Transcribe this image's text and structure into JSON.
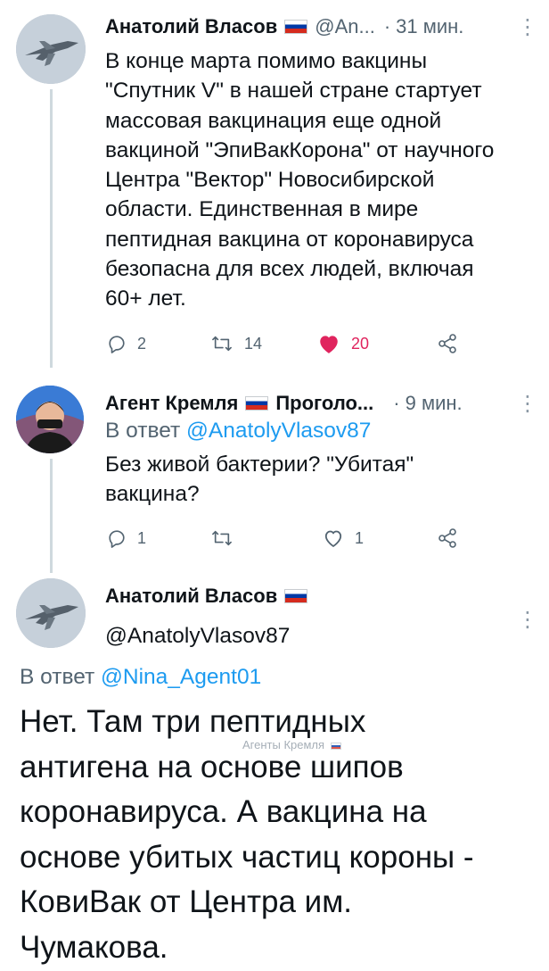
{
  "tweet1": {
    "author_name": "Анатолий Власов",
    "handle": "@An...",
    "separator": "·",
    "time": "31 мин.",
    "menu_glyph": "⋮",
    "lines": [
      "В конце марта помимо вакцины",
      "\"Спутник V\" в нашей стране стартует",
      "массовая вакцинация еще одной",
      "вакциной \"ЭпиВакКорона\" от научного",
      "Центра \"Вектор\" Новосибирской",
      "области. Единственная в мире",
      "пептидная вакцина от коронавируса",
      "безопасна для всех людей, включая",
      "60+ лет."
    ],
    "replies": "2",
    "retweets": "14",
    "likes": "20",
    "like_color": "#e0245e"
  },
  "tweet2": {
    "author_name": "Агент Кремля",
    "display_suffix": "Проголо...",
    "separator": "·",
    "time": "9 мин.",
    "menu_glyph": "⋮",
    "reply_prefix": "В ответ",
    "reply_to": "@AnatolyVlasov87",
    "lines": [
      "Без живой бактерии? \"Убитая\"",
      "вакцина?"
    ],
    "replies": "1",
    "retweets": "",
    "likes": "1"
  },
  "tweet3": {
    "author_name": "Анатолий Власов",
    "handle": "@AnatolyVlasov87",
    "menu_glyph": "⋮",
    "reply_prefix": "В ответ",
    "reply_to": "@Nina_Agent01",
    "lines": [
      "Нет. Там три пептидных",
      "антигена на основе шипов",
      "коронавируса. А вакцина на",
      "основе убитых частиц короны -",
      "КовиВак от Центра им.",
      "Чумакова."
    ]
  },
  "watermark": "Агенты Кремля",
  "colors": {
    "link": "#1d9bf0",
    "muted": "#536471",
    "thread_line": "#cfd9de"
  }
}
